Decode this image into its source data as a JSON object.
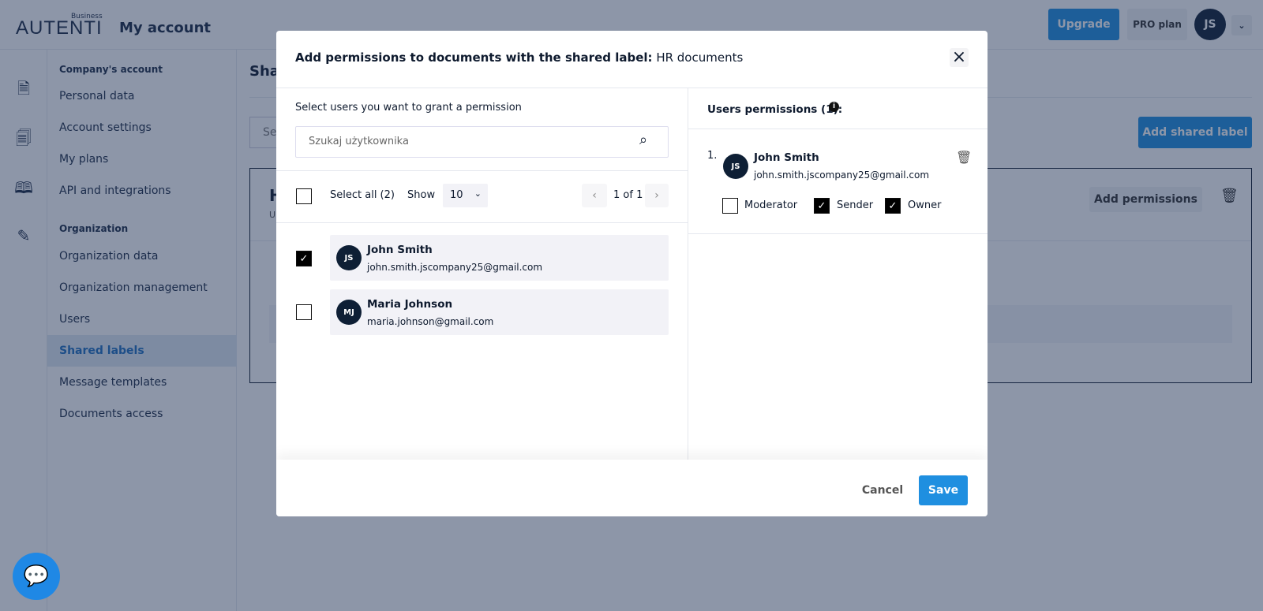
{
  "header": {
    "logo": "AUTENTI",
    "logo_sub": "Business",
    "title": "My account",
    "upgrade": "Upgrade",
    "plan": "PRO plan",
    "avatar": "JS"
  },
  "sidebar": {
    "sections": [
      {
        "heading": "Company's account",
        "items": [
          "Personal data",
          "Account settings",
          "My plans",
          "API and integrations"
        ]
      },
      {
        "heading": "Organization",
        "items": [
          "Organization data",
          "Organization management",
          "Users",
          "Shared labels",
          "Message templates",
          "Documents access"
        ]
      }
    ],
    "active": "Shared labels"
  },
  "page": {
    "title_partial": "Sha",
    "search_partial": "Sea",
    "add_shared_label": "Add shared label",
    "label_initial": "H",
    "label_sub_initial": "U",
    "add_permissions": "Add permissions"
  },
  "modal": {
    "title_prefix": "Add permissions to documents with the shared label:",
    "label_name": "HR documents",
    "left": {
      "prompt": "Select users you want to grant a permission",
      "search_placeholder": "Szukaj użytkownika",
      "select_all": "Select all (2)",
      "show_label": "Show",
      "show_value": "10",
      "pagination": "1 of 1",
      "users": [
        {
          "initials": "JS",
          "name": "John Smith",
          "email": "john.smith.jscompany25@gmail.com",
          "checked": true
        },
        {
          "initials": "MJ",
          "name": "Maria Johnson",
          "email": "maria.johnson@gmail.com",
          "checked": false
        }
      ]
    },
    "right": {
      "heading": "Users permissions (1):",
      "entries": [
        {
          "index": "1.",
          "initials": "JS",
          "name": "John Smith",
          "email": "john.smith.jscompany25@gmail.com",
          "roles": [
            {
              "label": "Moderator",
              "checked": false
            },
            {
              "label": "Sender",
              "checked": true
            },
            {
              "label": "Owner",
              "checked": true
            }
          ]
        }
      ]
    },
    "cancel": "Cancel",
    "save": "Save"
  },
  "colors": {
    "accent": "#1f8fe0",
    "primary_dark": "#0e1f35",
    "overlay": "#8c97ab"
  }
}
